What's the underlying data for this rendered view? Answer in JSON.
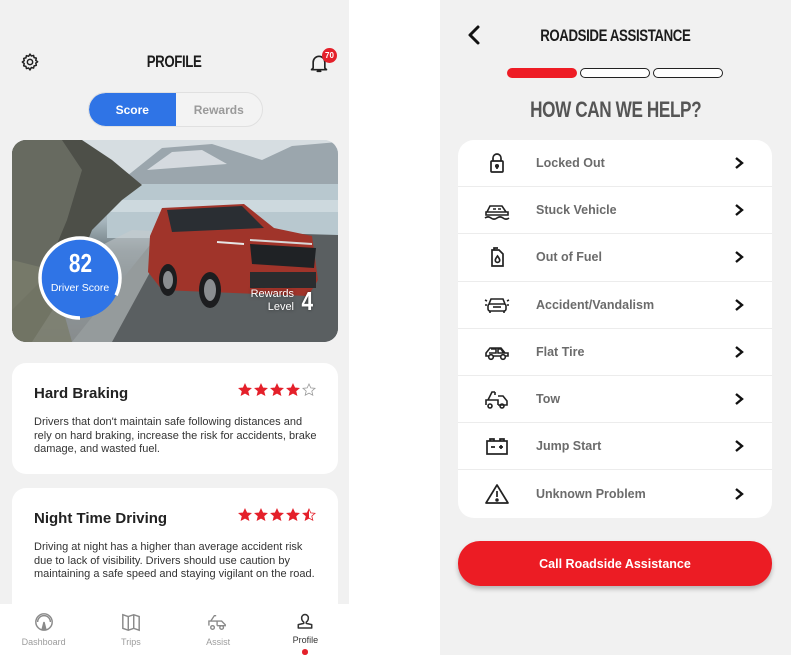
{
  "colors": {
    "accent_blue": "#2f74e6",
    "brand_red": "#ec1c24",
    "star_red": "#e4202a",
    "background": "#f1f1f1"
  },
  "profile": {
    "header": {
      "title": "PROFILE",
      "settings_icon": "gear-icon",
      "notifications_icon": "bell-icon",
      "notification_count": "70"
    },
    "segmented": {
      "options": [
        {
          "label": "Score",
          "active": true
        },
        {
          "label": "Rewards",
          "active": false
        }
      ]
    },
    "hero": {
      "driver_score": "82",
      "driver_score_label": "Driver Score",
      "driver_score_progress": 0.82,
      "rewards_label_line1": "Rewards",
      "rewards_label_line2": "Level",
      "rewards_level": "4"
    },
    "tips": [
      {
        "title": "Hard Braking",
        "rating": 4,
        "rating_max": 5,
        "body": "Drivers that don't maintain safe following distances and rely on hard braking, increase the risk for accidents, brake damage, and wasted fuel."
      },
      {
        "title": "Night Time Driving",
        "rating": 4.5,
        "rating_max": 5,
        "body": "Driving at night has a higher than average accident risk due to lack of visibility.  Drivers should use caution by maintaining a safe speed and staying vigilant on the road."
      }
    ],
    "tabbar": [
      {
        "label": "Dashboard",
        "icon": "speedometer-icon",
        "active": false
      },
      {
        "label": "Trips",
        "icon": "map-icon",
        "active": false
      },
      {
        "label": "Assist",
        "icon": "tow-truck-icon",
        "active": false
      },
      {
        "label": "Profile",
        "icon": "user-icon",
        "active": true
      }
    ]
  },
  "roadside": {
    "header": {
      "title": "ROADSIDE ASSISTANCE",
      "back_icon": "chevron-left-icon"
    },
    "steps": {
      "current": 1,
      "total": 3
    },
    "prompt": "HOW CAN WE HELP?",
    "options": [
      {
        "label": "Locked Out",
        "icon": "lock-icon"
      },
      {
        "label": "Stuck Vehicle",
        "icon": "stuck-car-icon"
      },
      {
        "label": "Out of Fuel",
        "icon": "fuel-can-icon"
      },
      {
        "label": "Accident/Vandalism",
        "icon": "car-accident-icon"
      },
      {
        "label": "Flat Tire",
        "icon": "car-icon"
      },
      {
        "label": "Tow",
        "icon": "tow-truck-icon"
      },
      {
        "label": "Jump Start",
        "icon": "battery-icon"
      },
      {
        "label": "Unknown Problem",
        "icon": "warning-icon"
      }
    ],
    "cta_label": "Call Roadside Assistance"
  }
}
